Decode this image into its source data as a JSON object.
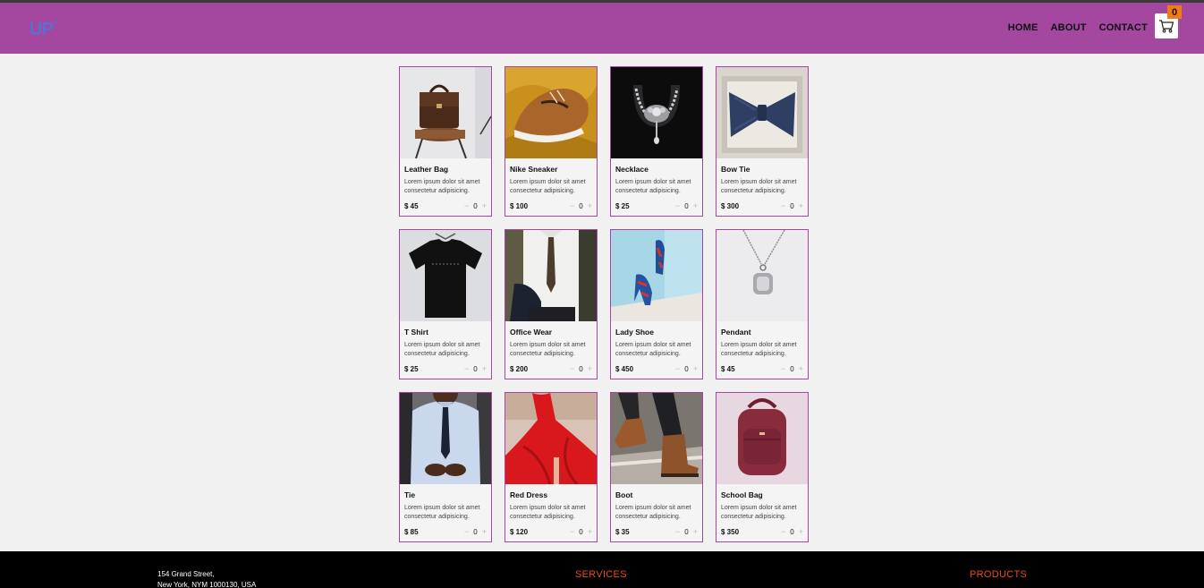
{
  "nav": {
    "logo": "UP",
    "logo_sup": "°°",
    "links": [
      "HOME",
      "ABOUT",
      "CONTACT"
    ],
    "cart_count": "0"
  },
  "products": [
    {
      "name": "Leather Bag",
      "desc": "Lorem ipsum dolor sit amet consectetur adipisicing.",
      "price": "$ 45",
      "qty": "0",
      "minus": "−",
      "plus": "+"
    },
    {
      "name": "Nike Sneaker",
      "desc": "Lorem ipsum dolor sit amet consectetur adipisicing.",
      "price": "$ 100",
      "qty": "0",
      "minus": "−",
      "plus": "+"
    },
    {
      "name": "Necklace",
      "desc": "Lorem ipsum dolor sit amet consectetur adipisicing.",
      "price": "$ 25",
      "qty": "0",
      "minus": "−",
      "plus": "+"
    },
    {
      "name": "Bow Tie",
      "desc": "Lorem ipsum dolor sit amet consectetur adipisicing.",
      "price": "$ 300",
      "qty": "0",
      "minus": "−",
      "plus": "+"
    },
    {
      "name": "T Shirt",
      "desc": "Lorem ipsum dolor sit amet consectetur adipisicing.",
      "price": "$ 25",
      "qty": "0",
      "minus": "−",
      "plus": "+"
    },
    {
      "name": "Office Wear",
      "desc": "Lorem ipsum dolor sit amet consectetur adipisicing.",
      "price": "$ 200",
      "qty": "0",
      "minus": "−",
      "plus": "+"
    },
    {
      "name": "Lady Shoe",
      "desc": "Lorem ipsum dolor sit amet consectetur adipisicing.",
      "price": "$ 450",
      "qty": "0",
      "minus": "−",
      "plus": "+"
    },
    {
      "name": "Pendant",
      "desc": "Lorem ipsum dolor sit amet consectetur adipisicing.",
      "price": "$ 45",
      "qty": "0",
      "minus": "−",
      "plus": "+"
    },
    {
      "name": "Tie",
      "desc": "Lorem ipsum dolor sit amet consectetur adipisicing.",
      "price": "$ 85",
      "qty": "0",
      "minus": "−",
      "plus": "+"
    },
    {
      "name": "Red Dress",
      "desc": "Lorem ipsum dolor sit amet consectetur adipisicing.",
      "price": "$ 120",
      "qty": "0",
      "minus": "−",
      "plus": "+"
    },
    {
      "name": "Boot",
      "desc": "Lorem ipsum dolor sit amet consectetur adipisicing.",
      "price": "$ 35",
      "qty": "0",
      "minus": "−",
      "plus": "+"
    },
    {
      "name": "School Bag",
      "desc": "Lorem ipsum dolor sit amet consectetur adipisicing.",
      "price": "$ 350",
      "qty": "0",
      "minus": "−",
      "plus": "+"
    }
  ],
  "footer": {
    "address_line1": "154 Grand Street,",
    "address_line2": "New York, NYM 1000130, USA",
    "services_heading": "SERVICES",
    "products_heading": "PRODUCTS"
  },
  "colors": {
    "navbar": "#a4479f",
    "card_border": "#a4479f",
    "cart_badge": "#f07c13",
    "footer_heading": "#f04a1a",
    "footer_bg": "#000000"
  }
}
